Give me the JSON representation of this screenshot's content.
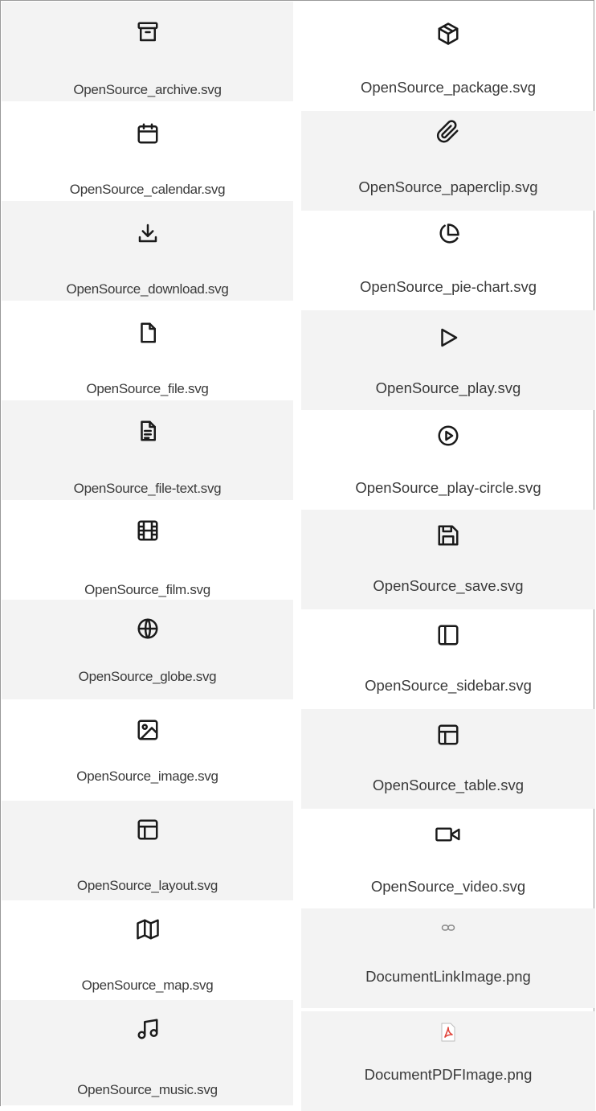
{
  "files_left": [
    {
      "icon": "archive-icon",
      "label": "OpenSource_archive.svg"
    },
    {
      "icon": "calendar-icon",
      "label": "OpenSource_calendar.svg"
    },
    {
      "icon": "download-icon",
      "label": "OpenSource_download.svg"
    },
    {
      "icon": "file-icon",
      "label": "OpenSource_file.svg"
    },
    {
      "icon": "file-text-icon",
      "label": "OpenSource_file-text.svg"
    },
    {
      "icon": "film-icon",
      "label": "OpenSource_film.svg"
    },
    {
      "icon": "globe-icon",
      "label": "OpenSource_globe.svg"
    },
    {
      "icon": "image-icon",
      "label": "OpenSource_image.svg"
    },
    {
      "icon": "layout-icon",
      "label": "OpenSource_layout.svg"
    },
    {
      "icon": "map-icon",
      "label": "OpenSource_map.svg"
    },
    {
      "icon": "music-icon",
      "label": "OpenSource_music.svg"
    }
  ],
  "files_right": [
    {
      "icon": "package-icon",
      "label": "OpenSource_package.svg"
    },
    {
      "icon": "paperclip-icon",
      "label": "OpenSource_paperclip.svg"
    },
    {
      "icon": "pie-chart-icon",
      "label": "OpenSource_pie-chart.svg"
    },
    {
      "icon": "play-icon",
      "label": "OpenSource_play.svg"
    },
    {
      "icon": "play-circle-icon",
      "label": "OpenSource_play-circle.svg"
    },
    {
      "icon": "save-icon",
      "label": "OpenSource_save.svg"
    },
    {
      "icon": "sidebar-icon",
      "label": "OpenSource_sidebar.svg"
    },
    {
      "icon": "table-icon",
      "label": "OpenSource_table.svg"
    },
    {
      "icon": "video-icon",
      "label": "OpenSource_video.svg"
    },
    {
      "icon": "link-icon",
      "label": "DocumentLinkImage.png"
    },
    {
      "icon": "pdf-icon",
      "label": "DocumentPDFImage.png"
    }
  ],
  "colors": {
    "tile_shade": "#f3f3f3",
    "icon_stroke": "#1a1a1a",
    "pdf_red": "#e0443a",
    "link_gray": "#8a8a8a"
  }
}
